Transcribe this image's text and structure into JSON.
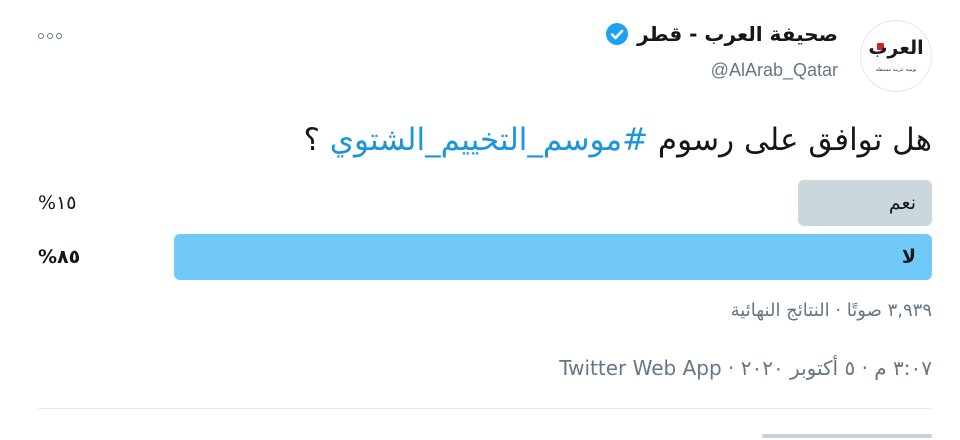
{
  "header": {
    "display_name": "صحيفة العرب - قطر",
    "handle": "@AlArab_Qatar",
    "verified_icon": "verified-badge-icon",
    "more_icon": "more-options-icon",
    "avatar_logo_text": "العرب",
    "avatar_logo_subtitle": "يومية عربية مستقلة"
  },
  "tweet": {
    "text_before": "هل  توافق على رسوم ",
    "hashtag": "#موسم_التخييم_الشتوي",
    "text_after": " ؟"
  },
  "poll": {
    "options": [
      {
        "label": "نعم",
        "percent_text": "%١٥",
        "percent": 15,
        "winner": false
      },
      {
        "label": "لا",
        "percent_text": "%٨٥",
        "percent": 85,
        "winner": true
      }
    ],
    "meta": "٣,٩٣٩ صوتًا · النتائج النهائية"
  },
  "timestamp": {
    "time_date": "٣:٠٧ م · ٥ أكتوبر ٢٠٢٠ · ",
    "source": "Twitter Web App"
  },
  "colors": {
    "accent": "#1b95e0",
    "winner_bar": "#71c9f8",
    "loser_bar": "#ccd6dd",
    "muted_text": "#657786",
    "verified": "#1da1f2"
  }
}
